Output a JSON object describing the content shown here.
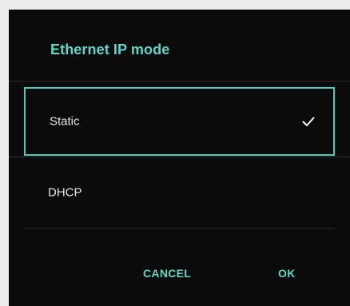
{
  "dialog": {
    "title": "Ethernet IP mode",
    "options": [
      {
        "label": "Static",
        "selected": true
      },
      {
        "label": "DHCP",
        "selected": false
      }
    ],
    "buttons": {
      "cancel": "CANCEL",
      "ok": "OK"
    },
    "icons": {
      "selected_marker": "check-icon"
    },
    "colors": {
      "accent": "#5ed6c7",
      "background": "#0b0b0b",
      "text": "#e6e6e6"
    }
  }
}
